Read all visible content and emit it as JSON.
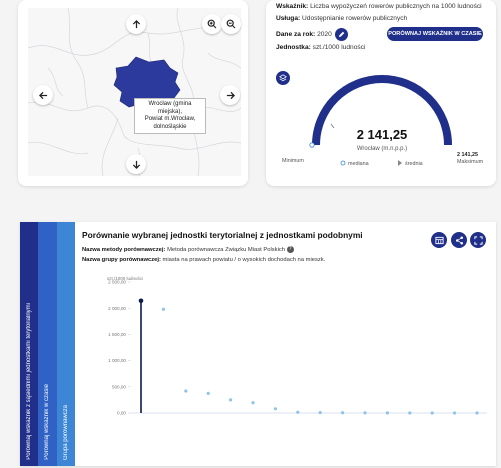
{
  "map": {
    "tooltip_lines": [
      "Wrocław (gmina miejska),",
      "Powiat m.Wrocław,",
      "dolnośląskie"
    ],
    "colors": {
      "region": "#2b3a9c",
      "background": "#f7f7f8"
    }
  },
  "info": {
    "indicator_label": "Wskaźnik:",
    "indicator_value": "Liczba wypożyczeń rowerów publicznych na 1000 ludności",
    "service_label": "Usługa:",
    "service_value": "Udostępnianie rowerów publicznych",
    "year_label": "Dane za rok:",
    "year_value": "2020",
    "unit_label": "Jednostka:",
    "unit_value": "szt./1000 ludności",
    "compare_time_button": "PORÓWNAJ WSKAŹNIK W CZASIE"
  },
  "gauge": {
    "value": "2 141,25",
    "unit_name": "Wrocław (m.n.p.p.)",
    "min_label": "Minimum",
    "max_value": "2 141,25",
    "max_label": "Maksimum",
    "median_label": "mediana",
    "mean_label": "średnia",
    "fill_fraction": 1.0,
    "accent": "#1f2f8a"
  },
  "comparison": {
    "title": "Porównanie wybranej jednostki terytorialnej z jednostkami podobnymi",
    "method_label": "Nazwa metody porównawczej:",
    "method_value": "Metoda porównawcza Związku Miast Polskich",
    "group_label": "Nazwa grupy porównawczej:",
    "group_value": "miasta na prawach powiatu / o wysokich dochodach na mieszk.",
    "tabs": [
      {
        "label": "Porównaj wskaźnik z sąsiednimi jednostkami terytorialnymi",
        "color": "#1f2f8a"
      },
      {
        "label": "Porównaj wskaźnik w czasie",
        "color": "#2f62c4"
      },
      {
        "label": "Grupa porównawcza",
        "color": "#3d86d6"
      }
    ]
  },
  "chart_data": {
    "type": "scatter",
    "ylabel": "szt./1000 ludności",
    "ylim": [
      0,
      2500
    ],
    "y_ticks": [
      0,
      500,
      1000,
      1500,
      2000,
      2500
    ],
    "y_tick_labels": [
      "0,00",
      "500,00",
      "1 000,00",
      "1 500,00",
      "2 000,00",
      "2 500,00"
    ],
    "grid": false,
    "series": [
      {
        "points": [
          {
            "x": 1,
            "y": 2141.25,
            "highlight": true
          },
          {
            "x": 2,
            "y": 1980
          },
          {
            "x": 3,
            "y": 420
          },
          {
            "x": 4,
            "y": 375
          },
          {
            "x": 5,
            "y": 250
          },
          {
            "x": 6,
            "y": 195
          },
          {
            "x": 7,
            "y": 80
          },
          {
            "x": 8,
            "y": 15
          },
          {
            "x": 9,
            "y": 8
          },
          {
            "x": 10,
            "y": 5
          },
          {
            "x": 11,
            "y": 3
          },
          {
            "x": 12,
            "y": 2
          },
          {
            "x": 13,
            "y": 1
          },
          {
            "x": 14,
            "y": 1
          },
          {
            "x": 15,
            "y": 0
          },
          {
            "x": 16,
            "y": 0
          }
        ]
      }
    ],
    "colors": {
      "highlight": "#0d1a4a",
      "others": "#8fc4ea"
    }
  }
}
